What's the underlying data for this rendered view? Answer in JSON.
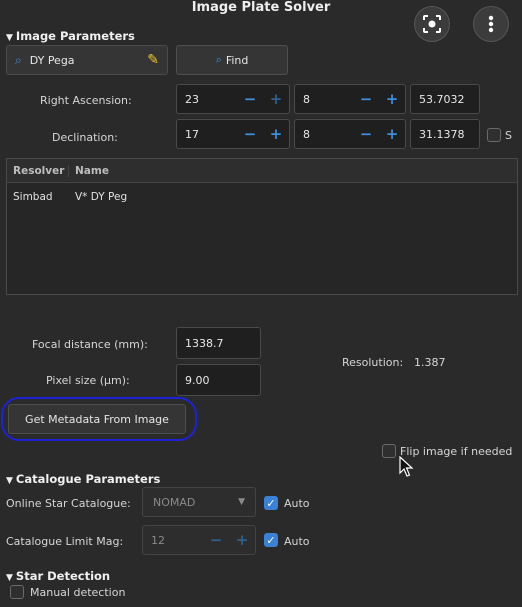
{
  "window": {
    "title": "Image Plate Solver"
  },
  "header_icons": {
    "lens": "lens-icon",
    "more": "more-vert-icon"
  },
  "image_params": {
    "section_label": "Image Parameters",
    "object_name": "DY Pega",
    "find_label": "Find",
    "ra_label": "Right Ascension:",
    "ra": {
      "h": "23",
      "m": "8",
      "s": "53.7032"
    },
    "dec_label": "Declination:",
    "dec": {
      "d": "17",
      "m": "8",
      "s": "31.1378"
    },
    "south_label": "S",
    "table": {
      "headers": [
        "Resolver",
        "Name"
      ],
      "rows": [
        {
          "resolver": "Simbad",
          "name": "V* DY Peg"
        }
      ]
    },
    "focal_label": "Focal distance (mm):",
    "focal_value": "1338.7",
    "pixel_label": "Pixel size (µm):",
    "pixel_value": "9.00",
    "resolution_label": "Resolution:",
    "resolution_value": "1.387",
    "metadata_button": "Get Metadata From Image",
    "flip_label": "Flip image if needed"
  },
  "catalogue_params": {
    "section_label": "Catalogue Parameters",
    "online_label": "Online Star Catalogue:",
    "online_value": "NOMAD",
    "limit_label": "Catalogue Limit Mag:",
    "limit_value": "12",
    "auto_label": "Auto"
  },
  "star_detection": {
    "section_label": "Star Detection",
    "manual_label": "Manual detection"
  },
  "colors": {
    "accent": "#3b82d6",
    "annotation": "#1c22d8"
  }
}
